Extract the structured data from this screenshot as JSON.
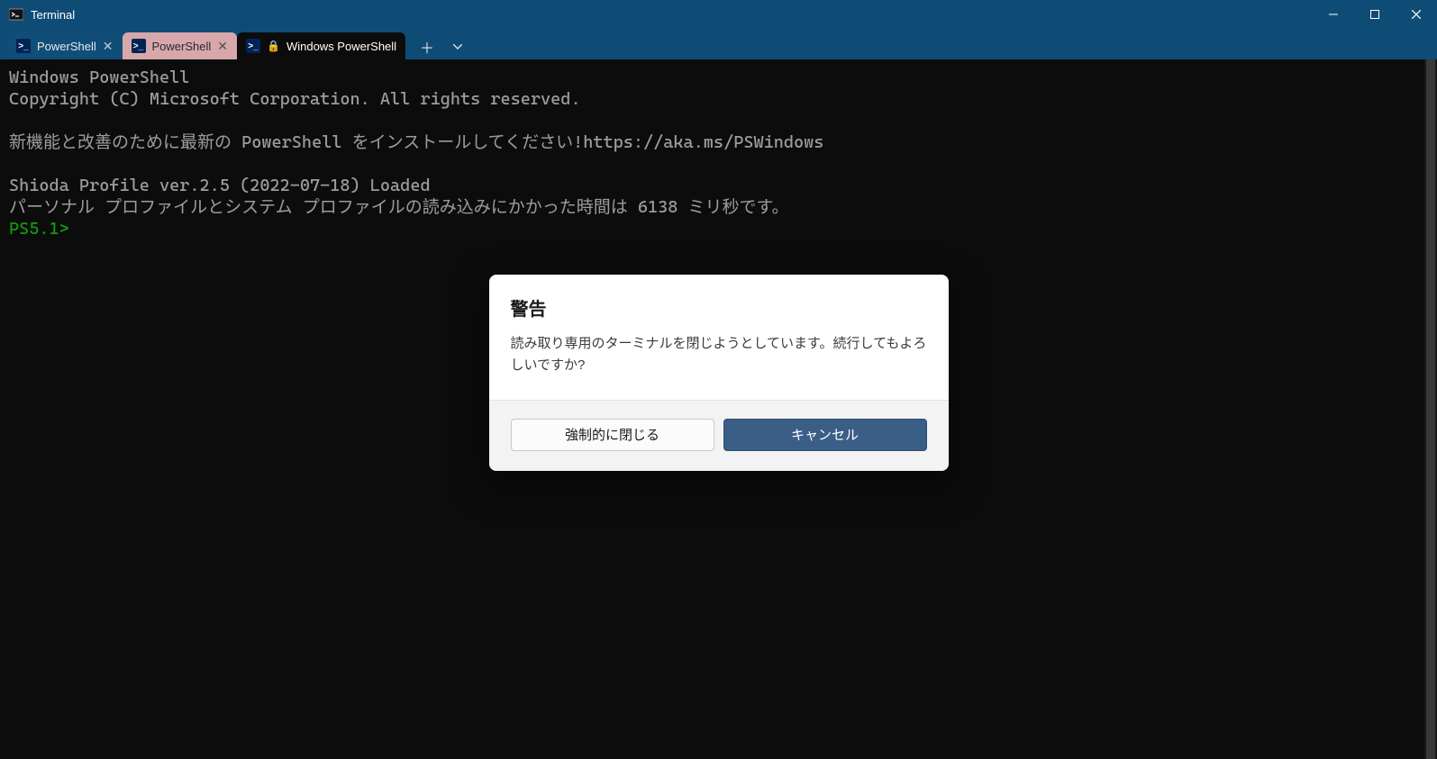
{
  "window": {
    "title": "Terminal"
  },
  "tabs": [
    {
      "label": "PowerShell",
      "has_lock": false
    },
    {
      "label": "PowerShell",
      "has_lock": false
    },
    {
      "label": "Windows PowerShell",
      "has_lock": true
    }
  ],
  "terminal": {
    "line1": "Windows PowerShell",
    "line2": "Copyright (C) Microsoft Corporation. All rights reserved.",
    "line3": "新機能と改善のために最新の PowerShell をインストールしてください!https://aka.ms/PSWindows",
    "line4": "Shioda Profile ver.2.5 (2022-07-18) Loaded",
    "line5": "パーソナル プロファイルとシステム プロファイルの読み込みにかかった時間は 6138 ミリ秒です。",
    "prompt": "PS5.1>"
  },
  "dialog": {
    "title": "警告",
    "message": "読み取り専用のターミナルを閉じようとしています。続行してもよろしいですか?",
    "force_close": "強制的に閉じる",
    "cancel": "キャンセル"
  }
}
